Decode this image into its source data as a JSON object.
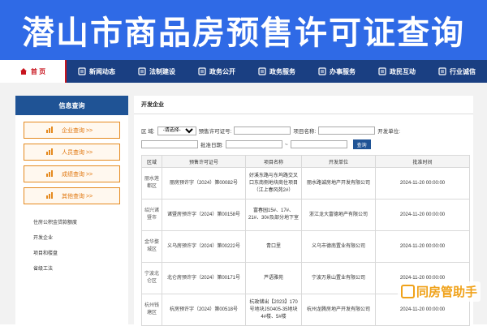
{
  "banner": {
    "title": "潜山市商品房预售许可证查询"
  },
  "nav": {
    "home": "首 页",
    "items": [
      {
        "label": "新闻动态",
        "icon": "newspaper-icon"
      },
      {
        "label": "法制建设",
        "icon": "law-book-icon"
      },
      {
        "label": "政务公开",
        "icon": "megaphone-icon"
      },
      {
        "label": "政务服务",
        "icon": "gear-icon"
      },
      {
        "label": "办事服务",
        "icon": "people-icon"
      },
      {
        "label": "政民互动",
        "icon": "chat-icon"
      },
      {
        "label": "行业诚信",
        "icon": "handshake-icon"
      }
    ]
  },
  "sidebar": {
    "title": "信息查询",
    "buttons": [
      {
        "label": "企业查询 >>",
        "icon": "bar-chart-icon"
      },
      {
        "label": "人员查询 >>",
        "icon": "person-icon"
      },
      {
        "label": "成绩查询 >>",
        "icon": "document-icon"
      },
      {
        "label": "其他查询 >>",
        "icon": "bar-chart-icon"
      }
    ],
    "links": [
      "住房公积金贷款额度",
      "开发企业",
      "项目和楼盘",
      "省级工法"
    ]
  },
  "main": {
    "heading": "开发企业",
    "filters": {
      "area_label": "区  域:",
      "area_value": "-请选择-",
      "permit_label": "预售许可证号:",
      "project_label": "项目名称:",
      "developer_label": "开发单位:",
      "date_label": "批准日期:",
      "date_sep": "~",
      "query_label": "查询"
    },
    "columns": [
      "区域",
      "预售许可证号",
      "项目名称",
      "开发单位",
      "批准时间"
    ],
    "rows": [
      {
        "area": "丽水莲都区",
        "permit": "丽房预许字（2024）第00082号",
        "project": "好溪东路与东坞路交叉口东南侧地块商住项目（江上春风苑2#）",
        "developer": "丽水路诚房地产开发有限公司",
        "date": "2024-11-20 00:00:00"
      },
      {
        "area": "绍兴诸暨市",
        "permit": "诸暨房预许字（2024）第00158号",
        "project": "富春园15#、17#、21#、30#及部分地下室",
        "developer": "浙江龙大富德地产有限公司",
        "date": "2024-11-20 00:00:00"
      },
      {
        "area": "金华婺城区",
        "permit": "义乌房预许字（2024）第00222号",
        "project": "青口里",
        "developer": "义乌市德南置业有限公司",
        "date": "2024-11-20 00:00:00"
      },
      {
        "area": "宁波北仑区",
        "permit": "北仑房预许字（2024）第00171号",
        "project": "芦语雅苑",
        "developer": "宁波万景山置业有限公司",
        "date": "2024-11-20 00:00:00"
      },
      {
        "area": "杭州钱塘区",
        "permit": "杭房预许字（2024）第00518号",
        "project": "杭政储出【2023】170号地块JS0405-35地块4#楼、5#楼",
        "developer": "杭州龙腾房地产开发有限公司",
        "date": "2024-11-20 00:00:00"
      }
    ]
  },
  "watermark": {
    "text": "同房管助手"
  }
}
